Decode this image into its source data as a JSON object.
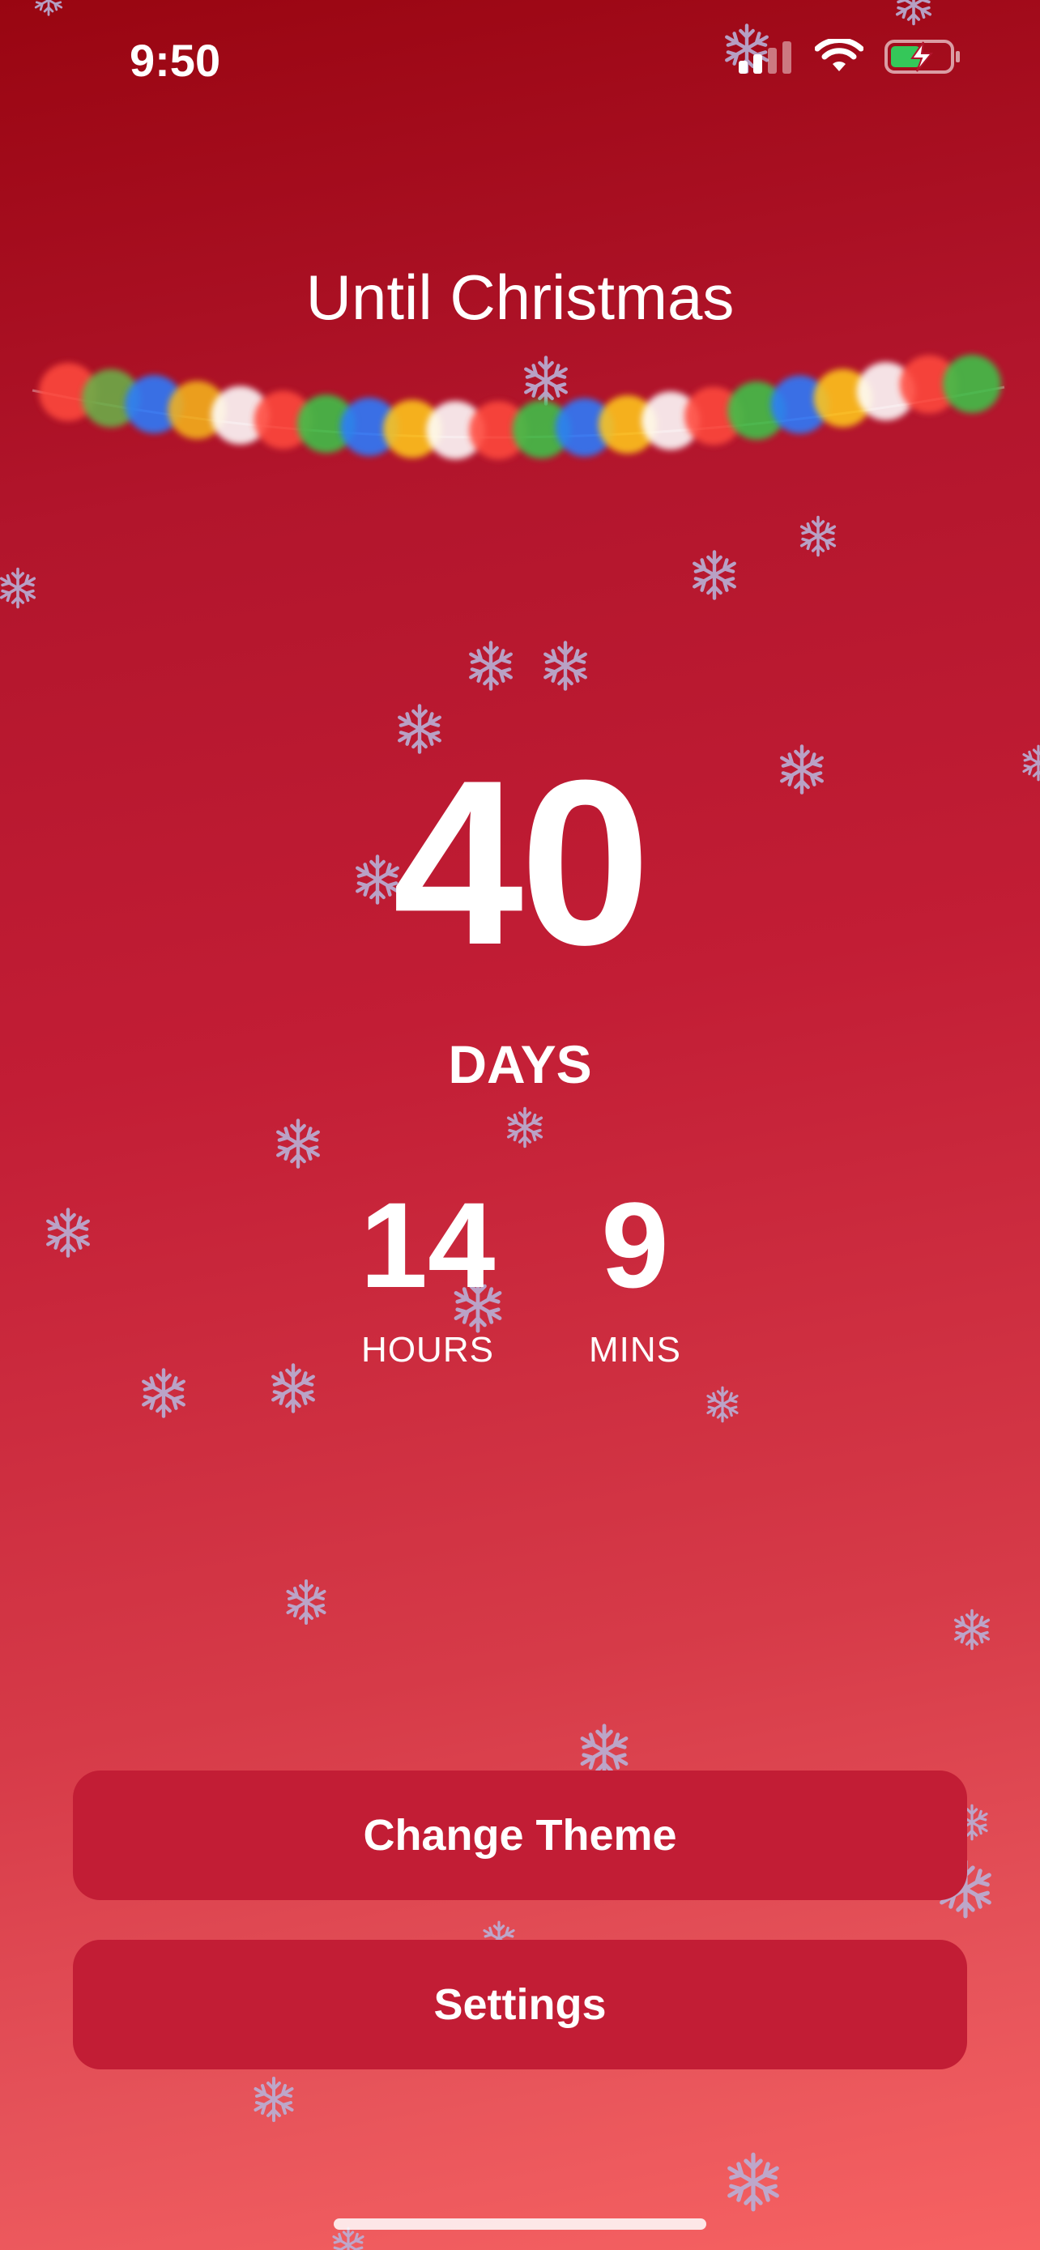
{
  "status_bar": {
    "time": "9:50",
    "icons": [
      "cellular-signal-icon",
      "wifi-icon",
      "battery-charging-icon"
    ]
  },
  "header": {
    "title": "Until Christmas"
  },
  "countdown": {
    "days": "40",
    "days_label": "DAYS",
    "hours": "14",
    "hours_label": "HOURS",
    "mins": "9",
    "mins_label": "MINS"
  },
  "actions": {
    "change_theme_label": "Change Theme",
    "settings_label": "Settings"
  },
  "colors": {
    "background_top": "#990511",
    "background_bottom": "#f76262",
    "button": "#c21d35",
    "text": "#ffffff"
  },
  "lights_colors": [
    "#ff4a3d",
    "#6bb04a",
    "#2b7bff",
    "#f4b21c",
    "#ffffff",
    "#ff4a3d",
    "#3ec24a",
    "#2b7bff",
    "#ffc61a",
    "#ffffff",
    "#ff4a3d",
    "#3ec24a",
    "#2b7bff",
    "#ffc61a",
    "#ffffff",
    "#ff4a3d",
    "#3ec24a",
    "#2b7bff",
    "#ffc61a",
    "#ffffff",
    "#ff4a3d",
    "#3ec24a"
  ]
}
